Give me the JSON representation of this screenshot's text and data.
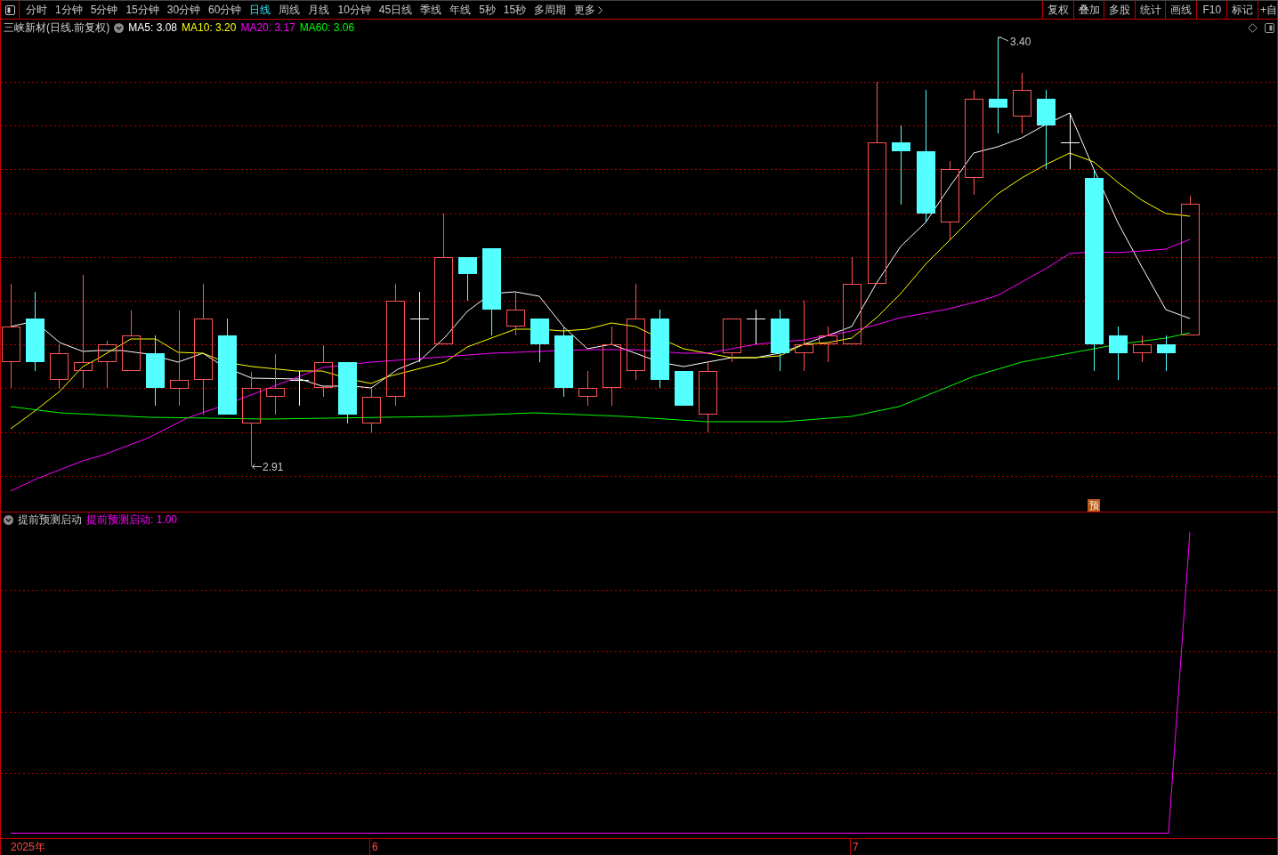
{
  "toolbar": {
    "periods": [
      {
        "label": "分时",
        "selected": false
      },
      {
        "label": "1分钟",
        "selected": false
      },
      {
        "label": "5分钟",
        "selected": false
      },
      {
        "label": "15分钟",
        "selected": false
      },
      {
        "label": "30分钟",
        "selected": false
      },
      {
        "label": "60分钟",
        "selected": false
      },
      {
        "label": "日线",
        "selected": true
      },
      {
        "label": "周线",
        "selected": false
      },
      {
        "label": "月线",
        "selected": false
      },
      {
        "label": "10分钟",
        "selected": false
      },
      {
        "label": "45日线",
        "selected": false
      },
      {
        "label": "季线",
        "selected": false
      },
      {
        "label": "年线",
        "selected": false
      },
      {
        "label": "5秒",
        "selected": false
      },
      {
        "label": "15秒",
        "selected": false
      },
      {
        "label": "多周期",
        "selected": false
      }
    ],
    "more": "更多",
    "actions": [
      "复权",
      "叠加",
      "多股",
      "统计",
      "画线",
      "F10",
      "标记",
      "+自"
    ]
  },
  "price_panel": {
    "title": "三峡新材(日线.前复权)",
    "indicators": [
      {
        "label": "MA5: 3.08",
        "color": "#ffffff"
      },
      {
        "label": "MA10: 3.20",
        "color": "#ffff00"
      },
      {
        "label": "MA20: 3.17",
        "color": "#ff00ff"
      },
      {
        "label": "MA60: 3.06",
        "color": "#00ff00"
      }
    ],
    "high_label": "3.40",
    "low_label": "2.91",
    "badge": "预"
  },
  "indicator_panel": {
    "title": "提前预测启动",
    "value": "提前预测启动: 1.00"
  },
  "time_axis": [
    "2025年",
    "6",
    "7"
  ]
}
